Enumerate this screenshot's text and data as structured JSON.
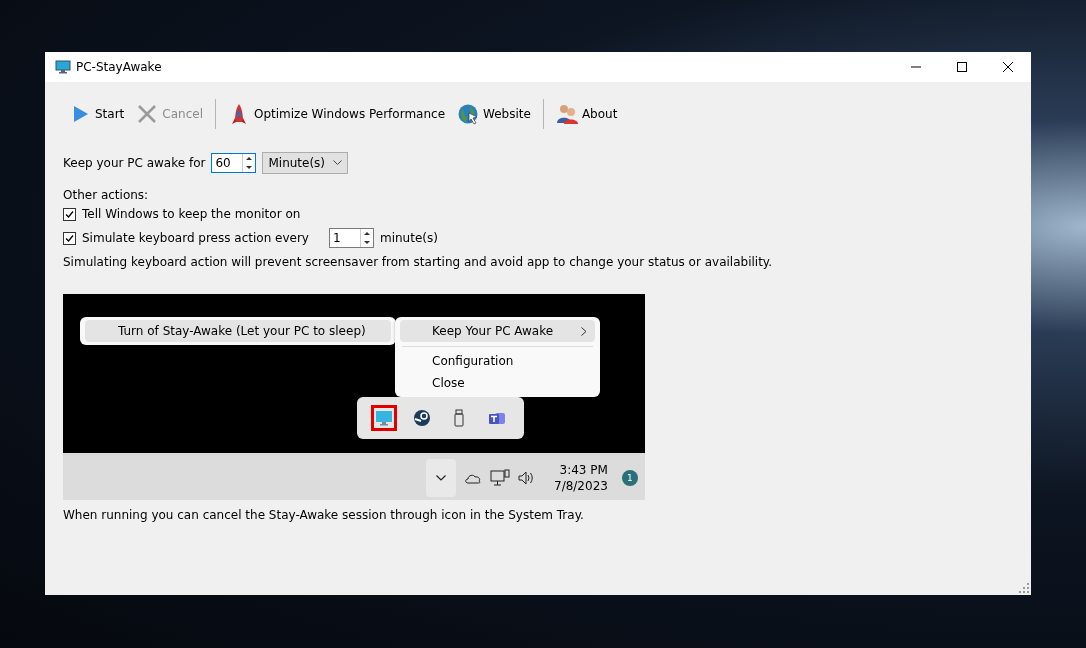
{
  "window": {
    "title": "PC-StayAwake"
  },
  "toolbar_groups": [
    [
      {
        "label": "Start",
        "kind": "start",
        "disabled": false
      },
      {
        "label": "Cancel",
        "kind": "cancel",
        "disabled": true
      }
    ],
    [
      {
        "label": "Optimize Windows Performance",
        "kind": "optimize",
        "disabled": false
      },
      {
        "label": "Website",
        "kind": "website",
        "disabled": false
      }
    ],
    [
      {
        "label": "About",
        "kind": "about",
        "disabled": false
      }
    ]
  ],
  "duration": {
    "label": "Keep your PC awake for",
    "value": "60",
    "unit": "Minute(s)"
  },
  "other_actions": {
    "heading": "Other actions:",
    "options": [
      {
        "label": "Tell Windows to keep the monitor on",
        "checked": true
      },
      {
        "label": "Simulate keyboard press action every",
        "checked": true,
        "interval": "1",
        "unit": "minute(s)"
      }
    ],
    "note": "Simulating keyboard action will prevent screensaver from starting and avoid app to change your status or availability."
  },
  "preview": {
    "menu_item": "Turn of Stay-Awake (Let your PC to sleep)",
    "submenu_groups": [
      [
        {
          "label": "Keep Your PC Awake",
          "has_submenu": true,
          "selected": true
        }
      ],
      [
        {
          "label": "Configuration",
          "has_submenu": false,
          "selected": false
        },
        {
          "label": "Close",
          "has_submenu": false,
          "selected": false
        }
      ]
    ],
    "tray_icons": [
      {
        "kind": "monitor",
        "highlighted": true
      },
      {
        "kind": "steam",
        "highlighted": false
      },
      {
        "kind": "usb",
        "highlighted": false
      },
      {
        "kind": "teams",
        "highlighted": false
      }
    ],
    "clock": {
      "time": "3:43 PM",
      "date": "7/8/2023"
    },
    "notification_count": "1"
  },
  "footer_note": "When running you can cancel the Stay-Awake session through icon in the System Tray."
}
